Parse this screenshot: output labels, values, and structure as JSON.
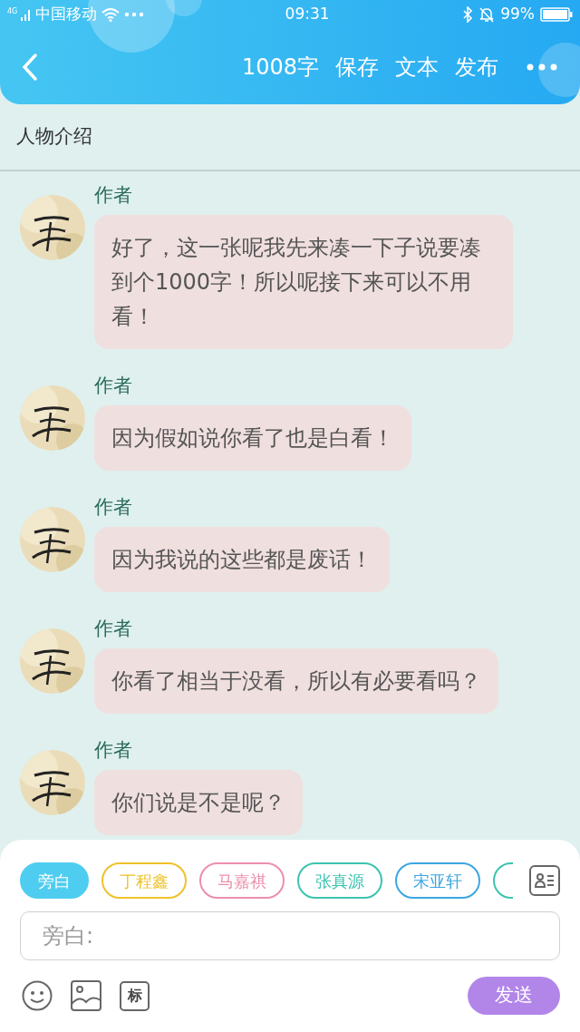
{
  "status_bar": {
    "carrier": "中国移动",
    "network": "4G",
    "time": "09:31",
    "battery": "99%"
  },
  "header": {
    "word_count": "1008字",
    "actions": [
      "保存",
      "文本",
      "发布"
    ]
  },
  "section_title": "人物介绍",
  "messages": [
    {
      "sender": "作者",
      "text": "好了，这一张呢我先来凑一下子说要凑到个1000字！所以呢接下来可以不用看！"
    },
    {
      "sender": "作者",
      "text": "因为假如说你看了也是白看！"
    },
    {
      "sender": "作者",
      "text": "因为我说的这些都是废话！"
    },
    {
      "sender": "作者",
      "text": "你看了相当于没看，所以有必要看吗？"
    },
    {
      "sender": "作者",
      "text": "你们说是不是呢？"
    }
  ],
  "roles": [
    {
      "label": "旁白",
      "color": "#4fcdf0",
      "selected": true
    },
    {
      "label": "丁程鑫",
      "color": "#eec22a",
      "selected": false
    },
    {
      "label": "马嘉祺",
      "color": "#ec8fab",
      "selected": false
    },
    {
      "label": "张真源",
      "color": "#3cc3b0",
      "selected": false
    },
    {
      "label": "宋亚轩",
      "color": "#3ba6e2",
      "selected": false
    },
    {
      "color": "#3cc3b0",
      "selected": false
    }
  ],
  "input": {
    "placeholder": "旁白:"
  },
  "tag_button": "标",
  "send_button": "发送"
}
